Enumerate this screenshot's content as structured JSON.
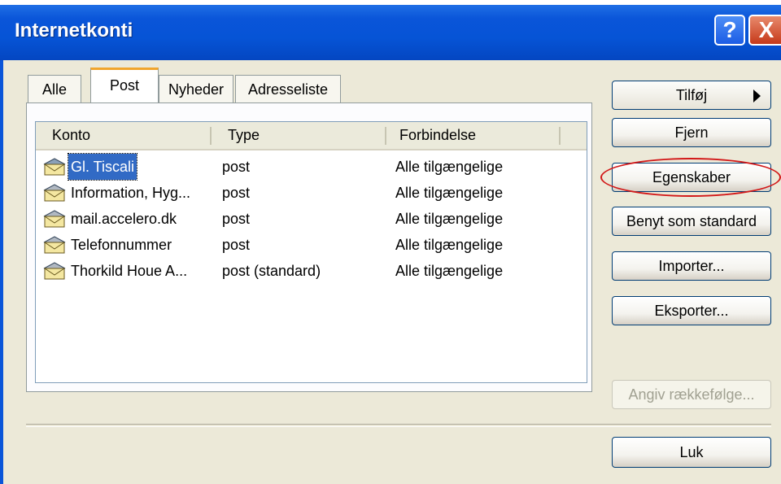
{
  "window": {
    "title": "Internetkonti"
  },
  "title_buttons": {
    "help": "?",
    "close": "X"
  },
  "tabs": [
    {
      "label": "Alle",
      "selected": false
    },
    {
      "label": "Post",
      "selected": true
    },
    {
      "label": "Nyheder",
      "selected": false
    },
    {
      "label": "Adresseliste",
      "selected": false
    }
  ],
  "columns": [
    "Konto",
    "Type",
    "Forbindelse"
  ],
  "accounts": [
    {
      "name": "Gl. Tiscali",
      "type": "post",
      "connection": "Alle tilgængelige",
      "selected": true
    },
    {
      "name": "Information, Hyg...",
      "type": "post",
      "connection": "Alle tilgængelige",
      "selected": false
    },
    {
      "name": "mail.accelero.dk",
      "type": "post",
      "connection": "Alle tilgængelige",
      "selected": false
    },
    {
      "name": "Telefonnummer",
      "type": "post",
      "connection": "Alle tilgængelige",
      "selected": false
    },
    {
      "name": "Thorkild Houe A...",
      "type": "post (standard)",
      "connection": "Alle tilgængelige",
      "selected": false
    }
  ],
  "buttons": {
    "add": "Tilføj",
    "remove": "Fjern",
    "properties": "Egenskaber",
    "set_default": "Benyt som standard",
    "import": "Importer...",
    "export": "Eksporter...",
    "set_order": "Angiv rækkefølge...",
    "close": "Luk"
  },
  "icons": {
    "account": "mail-account-icon",
    "submenu": "arrow-right-icon"
  },
  "colors": {
    "titlebar": "#0a55d9",
    "selection": "#316ac5",
    "highlight_ring": "#d21818",
    "tab_accent": "#f1a52c"
  }
}
